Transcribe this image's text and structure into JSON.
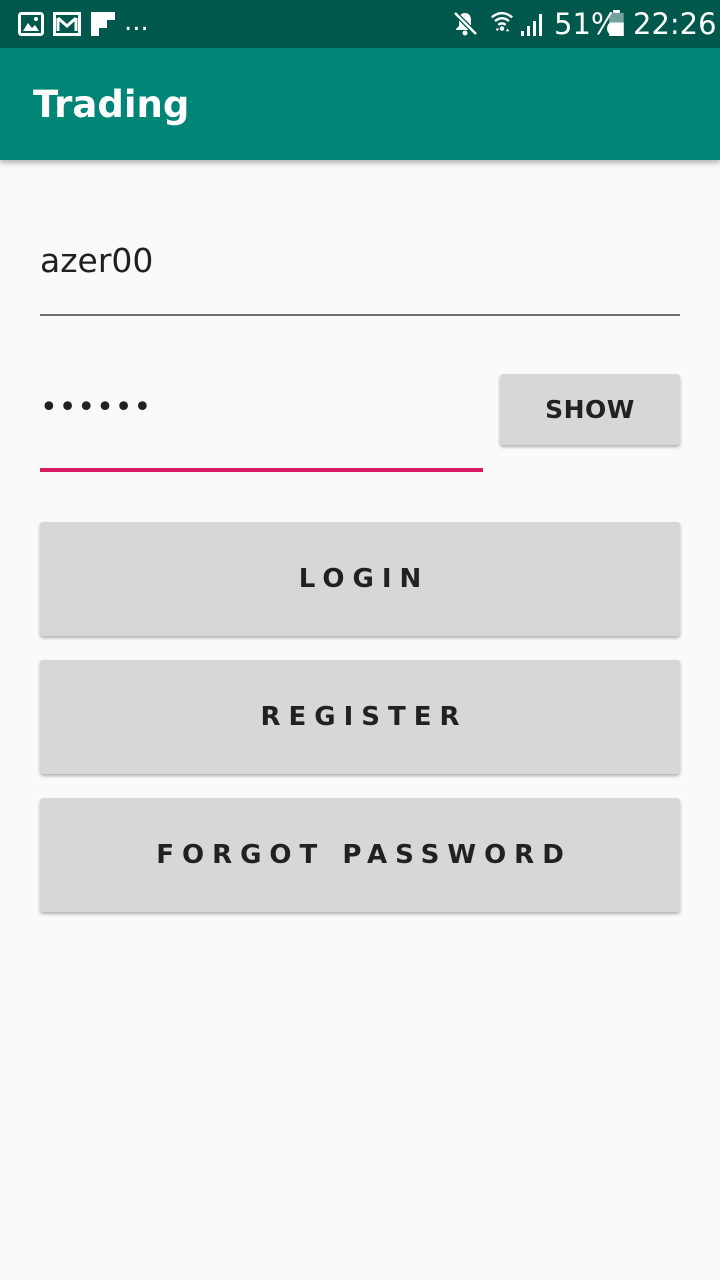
{
  "status_bar": {
    "icons_left": [
      "gallery-icon",
      "gmail-icon",
      "flipboard-icon"
    ],
    "more_indicator": "...",
    "icons_right": [
      "mute-icon",
      "wifi-icon",
      "signal-icon",
      "battery-icon"
    ],
    "battery_percent": "51%",
    "time": "22:26"
  },
  "app_bar": {
    "title": "Trading",
    "background_color": "#008577"
  },
  "form": {
    "username_value": "azer00",
    "password_value": "••••••",
    "show_button_label": "SHOW",
    "accent_color": "#d81b60"
  },
  "actions": {
    "login_label": "LOGIN",
    "register_label": "REGISTER",
    "forgot_password_label": "FORGOT PASSWORD"
  }
}
